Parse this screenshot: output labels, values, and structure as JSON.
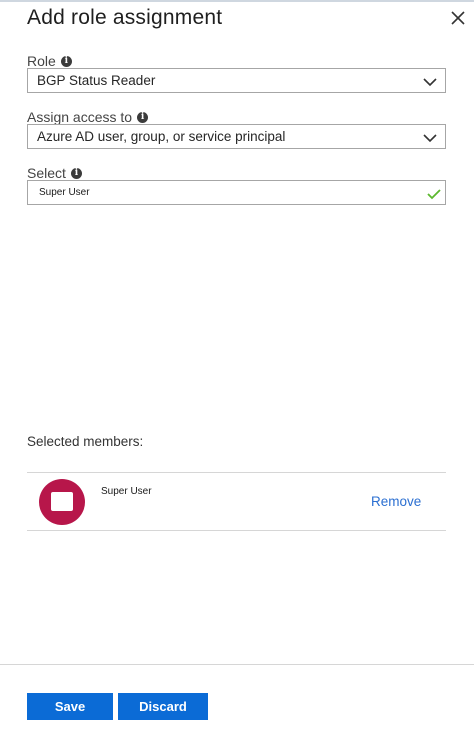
{
  "panel": {
    "title": "Add role assignment"
  },
  "fields": {
    "role": {
      "label": "Role",
      "value": "BGP Status Reader"
    },
    "assign_access": {
      "label": "Assign access to",
      "value": "Azure AD user, group, or service principal"
    },
    "select": {
      "label": "Select",
      "value": "Super User"
    }
  },
  "members": {
    "label": "Selected members:",
    "items": [
      {
        "name": "Super User",
        "action": "Remove"
      }
    ]
  },
  "footer": {
    "save_label": "Save",
    "discard_label": "Discard"
  },
  "colors": {
    "primary_button": "#0b6bd6",
    "link": "#2b6fd1",
    "avatar": "#b7164a",
    "valid_check": "#5cb82e"
  },
  "icons": {
    "close": "close-icon",
    "info": "info-icon",
    "dropdown": "chevron-down-icon",
    "valid": "checkmark-icon"
  }
}
